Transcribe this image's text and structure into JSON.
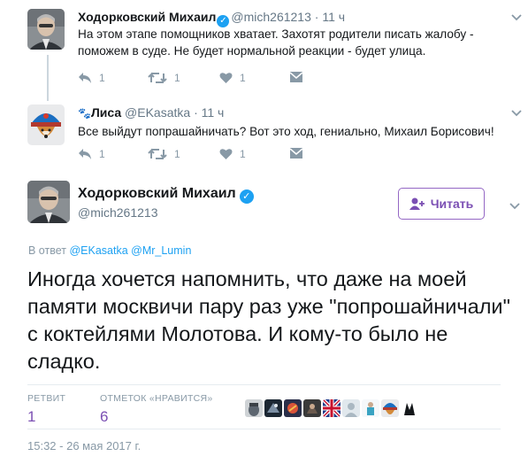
{
  "tweets": [
    {
      "name": "Ходорковский Михаил",
      "handle": "@mich261213",
      "separator": "·",
      "time": "11 ч",
      "text": "На этом этапе помощников хватает. Захотят родители писать жалобу - поможем в суде. Не будет нормальной реакции - будет улица.",
      "replies": "1",
      "retweets": "1",
      "likes": "1"
    },
    {
      "name_emoji": "🐾",
      "name": "Лиса",
      "handle": "@EKasatka",
      "separator": "·",
      "time": "11 ч",
      "text": "Все выйдут попрашайничать?  Вот это ход, гениально, Михаил Борисович!",
      "replies": "1",
      "retweets": "1",
      "likes": "1"
    }
  ],
  "main": {
    "name": "Ходорковский Михаил",
    "handle": "@mich261213",
    "follow_label": "Читать",
    "reply_prefix": "В ответ",
    "reply_mentions": "@EKasatka @Mr_Lumin",
    "text": "Иногда хочется напомнить, что даже на моей памяти москвичи пару раз уже \"попрошайничали\" с коктейлями Молотова. И кому-то было не сладко.",
    "retweets_label": "РЕТВИТ",
    "retweets_value": "1",
    "likes_label": "ОТМЕТОК «НРАВИТСЯ»",
    "likes_value": "6",
    "timestamp": "15:32 - 26 мая 2017 г."
  },
  "icons": {
    "verified": "verified-check-icon",
    "caret": "chevron-down-icon",
    "reply": "reply-icon",
    "retweet": "retweet-icon",
    "like": "heart-icon",
    "dm": "direct-message-icon",
    "follow": "add-user-icon"
  },
  "colors": {
    "verified": "#1da1f2",
    "follow_accent": "#7b4fb3",
    "mention": "#1da1f2",
    "muted": "#8899a6"
  }
}
